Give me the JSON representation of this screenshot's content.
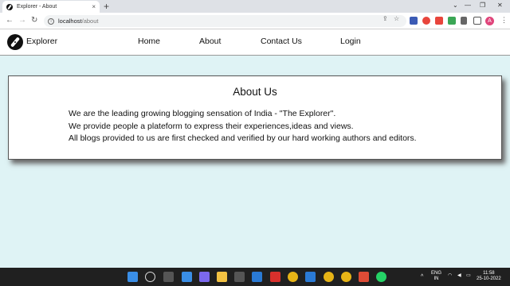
{
  "browser": {
    "tab_title": "Explorer - About",
    "tab_close": "×",
    "new_tab": "+",
    "window_controls": [
      "⌄",
      "—",
      "❐",
      "✕"
    ],
    "url_host": "localhost",
    "url_path": "/about",
    "back": "←",
    "forward": "→",
    "reload": "↻",
    "share": "⇪",
    "bookmark": "☆",
    "avatar_letter": "A",
    "menu": "⋮"
  },
  "site": {
    "brand": "Explorer",
    "nav": [
      "Home",
      "About",
      "Contact Us",
      "Login"
    ]
  },
  "about": {
    "title": "About Us",
    "lines": [
      "We are the leading growing blogging sensation of India - \"The Explorer\".",
      "We provide people a plateform to express their experiences,ideas and views.",
      "All blogs provided to us are first checked and verified by our hard working authors and editors."
    ]
  },
  "taskbar": {
    "language": "ENG",
    "region": "IN",
    "time": "11:58",
    "date": "25-10-2022",
    "icons": [
      "windows-icon",
      "search-icon",
      "task-view-icon",
      "widgets-icon",
      "chat-icon",
      "file-explorer-icon",
      "store-icon",
      "vscode-icon",
      "mcafee-icon",
      "chrome-icon",
      "vscode-icon",
      "chrome-icon",
      "chrome-icon",
      "git-icon",
      "whatsapp-icon"
    ]
  },
  "colors": {
    "page_bg": "#dff3f5",
    "avatar": "#e0457b",
    "taskbar": "#202020"
  }
}
